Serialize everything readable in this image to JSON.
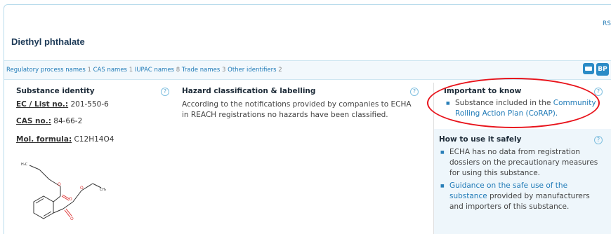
{
  "header": {
    "rs_label": "RS",
    "substance_title": "Diethyl phthalate"
  },
  "identifiers_bar": {
    "items": [
      {
        "label": "Regulatory process names",
        "count": "1"
      },
      {
        "label": "CAS names",
        "count": "1"
      },
      {
        "label": "IUPAC names",
        "count": "8"
      },
      {
        "label": "Trade names",
        "count": "3"
      },
      {
        "label": "Other identifiers",
        "count": "2"
      }
    ],
    "icons": [
      "print-icon",
      "bp-icon"
    ],
    "bp_label": "BP"
  },
  "identity": {
    "heading": "Substance identity",
    "ec_label": "EC / List no.:",
    "ec_value": "201-550-6",
    "cas_label": "CAS no.:",
    "cas_value": "84-66-2",
    "formula_label": "Mol. formula:",
    "formula_value": "C12H14O4",
    "help": "?"
  },
  "hazard": {
    "heading": "Hazard classification & labelling",
    "text": "According to the notifications provided by companies to ECHA in REACH registrations no hazards have been classified.",
    "help": "?"
  },
  "important": {
    "heading": "Important to know",
    "bullet_prefix": "Substance included in the ",
    "bullet_link": "Community Rolling Action Plan (CoRAP).",
    "help": "?"
  },
  "safe_use": {
    "heading": "How to use it safely",
    "bullet1": "ECHA has no data from registration dossiers on the precautionary measures for using this substance.",
    "bullet2_link": "Guidance on the safe use of the substance",
    "bullet2_rest": " provided by manufacturers and importers of this substance.",
    "help": "?"
  },
  "colors": {
    "accent": "#1f7ab7",
    "annotation_circle": "#e8131b",
    "panel_border": "#b9dcec"
  }
}
